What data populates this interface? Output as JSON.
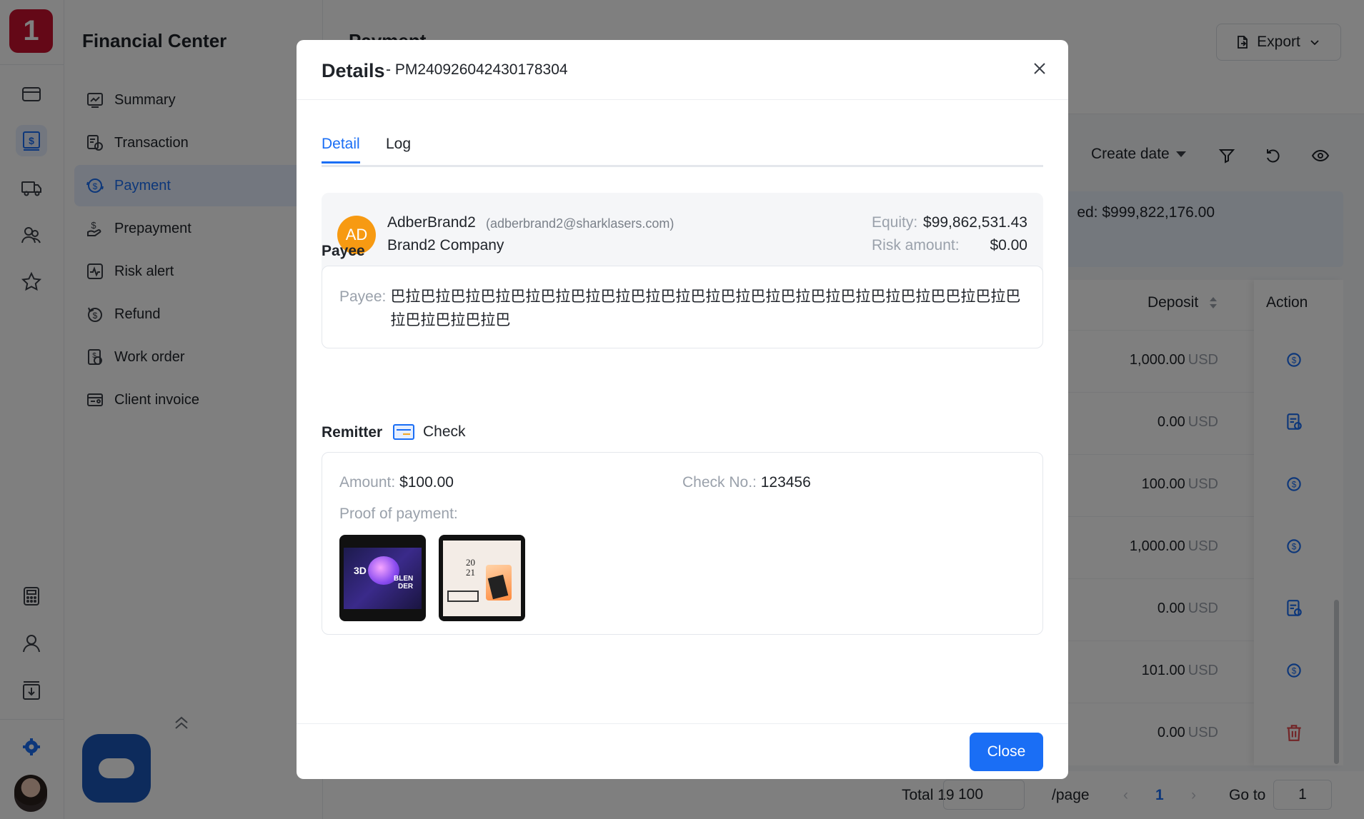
{
  "app": {
    "logo_text": "1",
    "sidebar_title": "Financial Center",
    "nav": [
      {
        "label": "Summary",
        "icon": "chart-icon"
      },
      {
        "label": "Transaction",
        "icon": "transaction-icon"
      },
      {
        "label": "Payment",
        "icon": "payment-icon"
      },
      {
        "label": "Prepayment",
        "icon": "prepayment-icon"
      },
      {
        "label": "Risk alert",
        "icon": "risk-alert-icon"
      },
      {
        "label": "Refund",
        "icon": "refund-icon"
      },
      {
        "label": "Work order",
        "icon": "work-order-icon"
      },
      {
        "label": "Client invoice",
        "icon": "client-invoice-icon"
      }
    ],
    "active_nav": "Payment"
  },
  "page": {
    "title": "Payment",
    "export_label": "Export",
    "sort_label": "Create date",
    "summary_text": "ed: $999,822,176.00",
    "columns": {
      "deposit": "Deposit",
      "action": "Action"
    },
    "rows": [
      {
        "deposit": "1,000.00",
        "currency": "USD",
        "action_icon": "payment-icon"
      },
      {
        "deposit": "0.00",
        "currency": "USD",
        "action_icon": "document-icon"
      },
      {
        "deposit": "100.00",
        "currency": "USD",
        "action_icon": "payment-icon"
      },
      {
        "deposit": "1,000.00",
        "currency": "USD",
        "action_icon": "payment-icon"
      },
      {
        "deposit": "0.00",
        "currency": "USD",
        "action_icon": "document-icon"
      },
      {
        "deposit": "101.00",
        "currency": "USD",
        "action_icon": "payment-icon"
      },
      {
        "deposit": "0.00",
        "currency": "USD",
        "action_icon": "trash-icon"
      }
    ],
    "pager": {
      "total": "Total 19",
      "page_size": "100",
      "unit": "/page",
      "prev": "‹",
      "current": "1",
      "next": "›",
      "goto_label": "Go to",
      "goto_value": "1"
    }
  },
  "modal": {
    "title": "Details",
    "id_text": "- PM240926042430178304",
    "tabs": [
      {
        "label": "Detail"
      },
      {
        "label": "Log"
      }
    ],
    "active_tab": "Detail",
    "client": {
      "initials": "AD",
      "name": "AdberBrand2",
      "email": "(adberbrand2@sharklasers.com)",
      "company": "Brand2 Company",
      "equity_label": "Equity:",
      "equity_value": "$99,862,531.43",
      "risk_label": "Risk amount:",
      "risk_value": "$0.00"
    },
    "payee": {
      "section_label": "Payee",
      "label": "Payee:",
      "value": "巴拉巴拉巴拉巴拉巴拉巴拉巴拉巴拉巴拉巴拉巴拉巴拉巴拉巴拉巴拉巴拉巴拉巴拉巴巴拉巴拉巴拉巴拉巴拉巴拉巴"
    },
    "remitter": {
      "section_label": "Remitter",
      "method": "Check",
      "amount_label": "Amount:",
      "amount_value": "$100.00",
      "check_label": "Check No.:",
      "check_value": "123456",
      "proof_label": "Proof of payment:",
      "thumb1": {
        "text_a": "3D",
        "text_b": "BLEN",
        "text_c": "DER"
      },
      "thumb2": {
        "text_a": "20",
        "text_b": "21"
      }
    },
    "close_label": "Close"
  }
}
